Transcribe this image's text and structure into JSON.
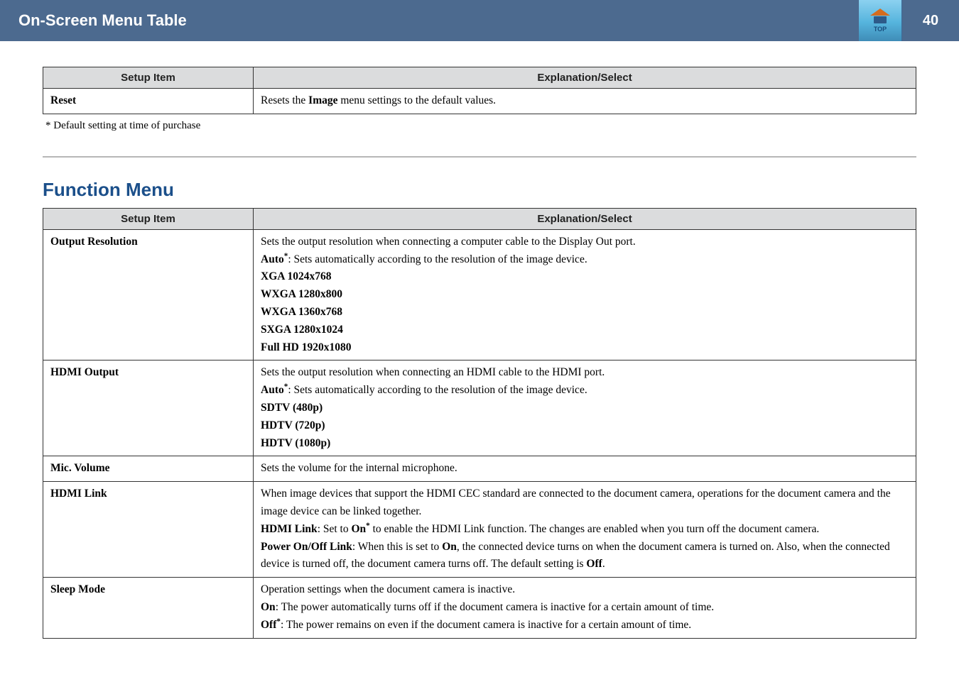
{
  "header": {
    "title": "On-Screen Menu Table",
    "logo_text": "TOP",
    "page_number": "40"
  },
  "table1": {
    "head_col1": "Setup Item",
    "head_col2": "Explanation/Select",
    "rows": [
      {
        "c1": "Reset",
        "c2_pre": "Resets the ",
        "c2_bold": "Image",
        "c2_post": " menu settings to the default values."
      }
    ]
  },
  "footnote": "* Default setting at time of purchase",
  "section2_title": "Function Menu",
  "table2": {
    "head_col1": "Setup Item",
    "head_col2": "Explanation/Select",
    "r_output_res": {
      "c1": "Output Resolution",
      "l1": "Sets the output resolution when connecting a computer cable to the Display Out port.",
      "l2_bold": "Auto",
      "l2_rest": ": Sets automatically according to the resolution of the image device.",
      "l3": "XGA 1024x768",
      "l4": "WXGA 1280x800",
      "l5": "WXGA 1360x768",
      "l6": "SXGA 1280x1024",
      "l7": "Full HD 1920x1080"
    },
    "r_hdmi_output": {
      "c1": "HDMI Output",
      "l1": "Sets the output resolution when connecting an HDMI cable to the HDMI port.",
      "l2_bold": "Auto",
      "l2_rest": ": Sets automatically according to the resolution of the image device.",
      "l3": "SDTV (480p)",
      "l4": "HDTV (720p)",
      "l5": "HDTV (1080p)"
    },
    "r_mic": {
      "c1": "Mic. Volume",
      "l1": "Sets the volume for the internal microphone."
    },
    "r_hdmi_link": {
      "c1": "HDMI Link",
      "l1": "When image devices that support the HDMI CEC standard are connected to the document camera, operations for the document camera and the image device can be linked together.",
      "l2_b1": "HDMI Link",
      "l2_t1": ": Set to ",
      "l2_b2": "On",
      "l2_t2": " to enable the HDMI Link function. The changes are enabled when you turn off the document camera.",
      "l3_b1": "Power On/Off Link",
      "l3_t1": ": When this is set to ",
      "l3_b2": "On",
      "l3_t2": ", the connected device turns on when the document camera is turned on. Also, when the connected device is turned off, the document camera turns off. The default setting is ",
      "l3_b3": "Off",
      "l3_t3": "."
    },
    "r_sleep": {
      "c1": "Sleep Mode",
      "l1": "Operation settings when the document camera is inactive.",
      "l2_b": "On",
      "l2_t": ": The power automatically turns off if the document camera is inactive for a certain amount of time.",
      "l3_b": "Off",
      "l3_t": ": The power remains on even if the document camera is inactive for a certain amount of time."
    }
  }
}
